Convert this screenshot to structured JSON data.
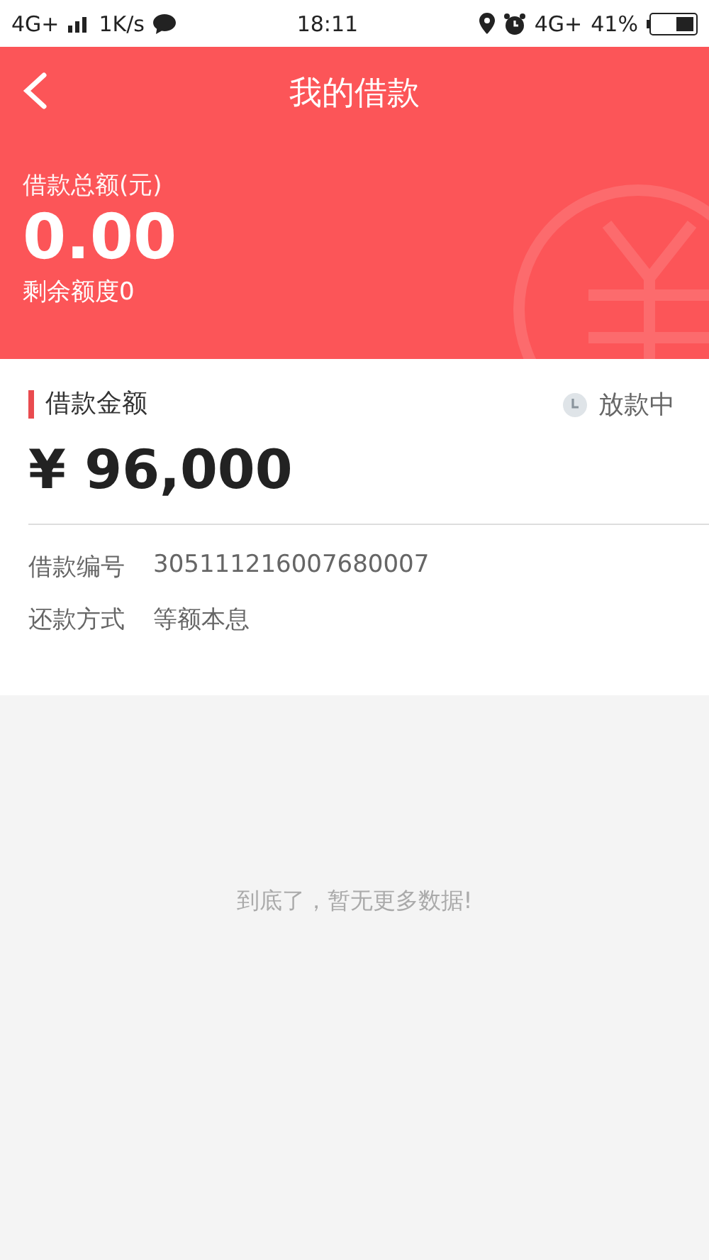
{
  "status_bar": {
    "network": "4G+",
    "speed": "1K/s",
    "time": "18:11",
    "network_right": "4G+",
    "battery": "41%"
  },
  "nav": {
    "title": "我的借款"
  },
  "summary": {
    "label": "借款总额(元)",
    "amount": "0.00",
    "remaining": "剩余额度0"
  },
  "loan": {
    "title": "借款金额",
    "status": "放款中",
    "amount": "¥ 96,000",
    "details": [
      {
        "label": "借款编号",
        "value": "305111216007680007"
      },
      {
        "label": "还款方式",
        "value": "等额本息"
      }
    ]
  },
  "footer": {
    "text": "到底了，暂无更多数据!"
  }
}
